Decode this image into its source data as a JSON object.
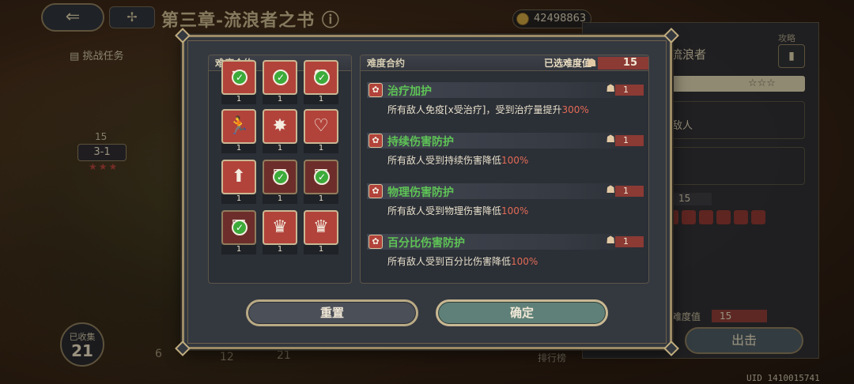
{
  "hud": {
    "back_icon": "back-arrow-icon",
    "grid_icon": "grid-icon",
    "chapter_title": "第三章-流浪者之书",
    "info_icon": "info-icon",
    "currency_value": "42498863",
    "challenge_task_label": "挑战任务",
    "stage": {
      "cost": "15",
      "name": "3-1",
      "stars": "★★★"
    },
    "collected": {
      "label": "已收集",
      "count": "21"
    },
    "map_numbers": [
      "6",
      "12",
      "21"
    ],
    "rank_label": "排行榜",
    "uid": "UID 1410015741"
  },
  "side_panel": {
    "title": "流浪者",
    "guide_label": "攻略",
    "enemy_label": "敌人",
    "stars": "☆☆☆",
    "cost": "15",
    "difficulty_label": "难度值",
    "difficulty_value": "15",
    "go_label": "出击"
  },
  "modal": {
    "left_header": "难度合约",
    "right_header": "难度合约",
    "selected_label": "已选难度值",
    "selected_value": "15",
    "contracts": [
      {
        "glyph": "▼",
        "checked": true,
        "dark": false,
        "count": "1",
        "partial": true
      },
      {
        "glyph": "⊘",
        "checked": true,
        "dark": false,
        "count": "1",
        "partial": true
      },
      {
        "glyph": "♥",
        "checked": true,
        "dark": false,
        "count": "1",
        "partial": true
      },
      {
        "glyph": "🏃",
        "checked": false,
        "dark": false,
        "count": "1"
      },
      {
        "glyph": "✸",
        "checked": false,
        "dark": false,
        "count": "1"
      },
      {
        "glyph": "♡",
        "checked": false,
        "dark": false,
        "count": "1"
      },
      {
        "glyph": "⬆",
        "checked": false,
        "dark": false,
        "count": "1"
      },
      {
        "glyph": "⛉",
        "checked": true,
        "dark": true,
        "count": "1"
      },
      {
        "glyph": "⛉",
        "checked": true,
        "dark": true,
        "count": "1"
      },
      {
        "glyph": "⛉",
        "checked": true,
        "dark": true,
        "count": "1"
      },
      {
        "glyph": "♛",
        "checked": false,
        "dark": false,
        "count": "1"
      },
      {
        "glyph": "♛",
        "checked": false,
        "dark": false,
        "count": "1"
      }
    ],
    "rules": [
      {
        "name": "治疗加护",
        "cost": "1",
        "desc_prefix": "所有敌人免疫[x受治疗]，受到治疗量提升",
        "desc_value": "300%"
      },
      {
        "name": "持续伤害防护",
        "cost": "1",
        "desc_prefix": "所有敌人受到持续伤害降低",
        "desc_value": "100%"
      },
      {
        "name": "物理伤害防护",
        "cost": "1",
        "desc_prefix": "所有敌人受到物理伤害降低",
        "desc_value": "100%"
      },
      {
        "name": "百分比伤害防护",
        "cost": "1",
        "desc_prefix": "所有敌人受到百分比伤害降低",
        "desc_value": "100%"
      }
    ],
    "reset_label": "重置",
    "confirm_label": "确定"
  }
}
